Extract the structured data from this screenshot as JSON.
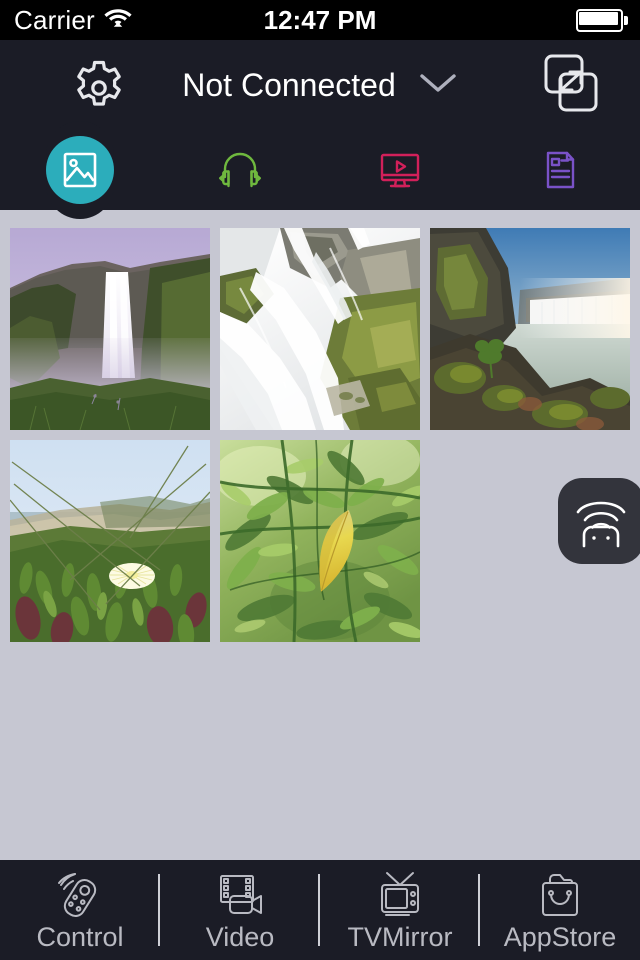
{
  "status_bar": {
    "carrier": "Carrier",
    "wifi_icon": "wifi-icon",
    "time": "12:47 PM",
    "battery_icon": "battery-full-icon",
    "battery_level": 100
  },
  "nav_bar": {
    "settings_icon": "gear-icon",
    "connection_status": "Not Connected",
    "chevron_icon": "chevron-down-icon",
    "mirror_icon": "screen-mirror-icon",
    "background_color": "#1b1c26"
  },
  "tab_bar": {
    "selected_index": 0,
    "selected_color": "#2cadbb",
    "tabs": [
      {
        "name": "photos",
        "icon": "photo-icon",
        "color": "#ffffff",
        "selected": true
      },
      {
        "name": "audio",
        "icon": "headphones-icon",
        "color": "#6fb83e",
        "selected": false
      },
      {
        "name": "video",
        "icon": "monitor-play-icon",
        "color": "#d2205a",
        "selected": false
      },
      {
        "name": "documents",
        "icon": "document-icon",
        "color": "#7a52c8",
        "selected": false
      }
    ]
  },
  "content": {
    "background_color": "#c6c7d2",
    "photos": [
      {
        "name": "waterfall-cliff-purple-sky",
        "alt": "Tall waterfall over green cliff under purple sky"
      },
      {
        "name": "cascading-waterfall-mossy-rocks",
        "alt": "White cascading water over mossy rocks"
      },
      {
        "name": "wide-waterfall-lagoon",
        "alt": "Wide waterfall flowing into misty lagoon"
      },
      {
        "name": "dune-flower-beach",
        "alt": "White flower among succulents on coastal dune"
      },
      {
        "name": "yellow-leaf-green-foliage",
        "alt": "Yellow leaf among sunlit green foliage"
      }
    ]
  },
  "cast_button": {
    "name": "cast-device-button",
    "icon": "cast-wifi-icon",
    "background_color": "#33343c"
  },
  "toolbar": {
    "background_color": "#1b1c26",
    "items": [
      {
        "name": "control",
        "label": "Control",
        "icon": "remote-control-icon"
      },
      {
        "name": "video",
        "label": "Video",
        "icon": "video-camera-icon"
      },
      {
        "name": "tvmirror",
        "label": "TVMirror",
        "icon": "tv-icon"
      },
      {
        "name": "appstore",
        "label": "AppStore",
        "icon": "appstore-bag-icon"
      }
    ]
  }
}
